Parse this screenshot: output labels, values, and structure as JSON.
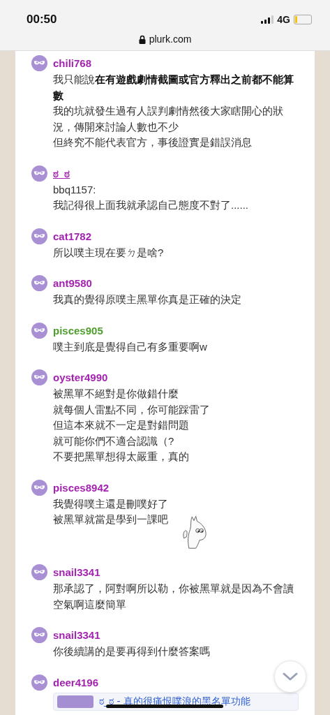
{
  "status_bar": {
    "time": "00:50",
    "network": "4G"
  },
  "address_bar": {
    "url": "plurk.com"
  },
  "comments": [
    {
      "name": "chili768",
      "color": "#a323b0",
      "underlined": false,
      "lines": [
        "我只能說**在有遊戲劇情截圖或官方釋出之前都不能算數**",
        "我的坑就發生過有人誤判劇情然後大家瞎開心的狀況，傳開來討論人數也不少",
        "但終究不能代表官方，事後證實是錯誤消息"
      ]
    },
    {
      "name": "ಠ_ಠ",
      "color": "#a323b0",
      "underlined": true,
      "lines": [
        "bbq1157:",
        "我記得很上面我就承認自己態度不對了......"
      ]
    },
    {
      "name": "cat1782",
      "color": "#a323b0",
      "underlined": false,
      "lines": [
        "所以噗主現在要ㄉ是啥?"
      ]
    },
    {
      "name": "ant9580",
      "color": "#a323b0",
      "underlined": false,
      "lines": [
        "我真的覺得原噗主黑單你真是正確的決定"
      ]
    },
    {
      "name": "pisces905",
      "color": "#4d9e2c",
      "underlined": false,
      "lines": [
        "噗主到底是覺得自己有多重要啊w"
      ]
    },
    {
      "name": "oyster4990",
      "color": "#a323b0",
      "underlined": false,
      "lines": [
        "被黑單不絕對是你做錯什麼",
        "就每個人雷點不同，你可能踩雷了",
        "但這本來就不一定是對錯問題",
        "就可能你們不適合認識（?",
        "不要把黑單想得太嚴重，真的"
      ]
    },
    {
      "name": "pisces8942",
      "color": "#a323b0",
      "underlined": false,
      "lines": [
        "我覺得噗主還是刪噗好了",
        "被黑單就當是學到一課吧"
      ],
      "sticker": {
        "kind": "picture"
      }
    },
    {
      "name": "snail3341",
      "color": "#a323b0",
      "underlined": false,
      "lines": [
        "那承認了，阿對啊所以勒，你被黑單就是因為不會讀空氣啊這麼簡單"
      ]
    },
    {
      "name": "snail3341",
      "color": "#a323b0",
      "underlined": false,
      "lines": [
        "你後續講的是要再得到什麼答案嗎"
      ]
    },
    {
      "name": "deer4196",
      "color": "#a323b0",
      "underlined": false,
      "link_card": {
        "title": "ಠ_ಠ - 真的很痛恨噗浪的黑名單功能"
      }
    }
  ]
}
